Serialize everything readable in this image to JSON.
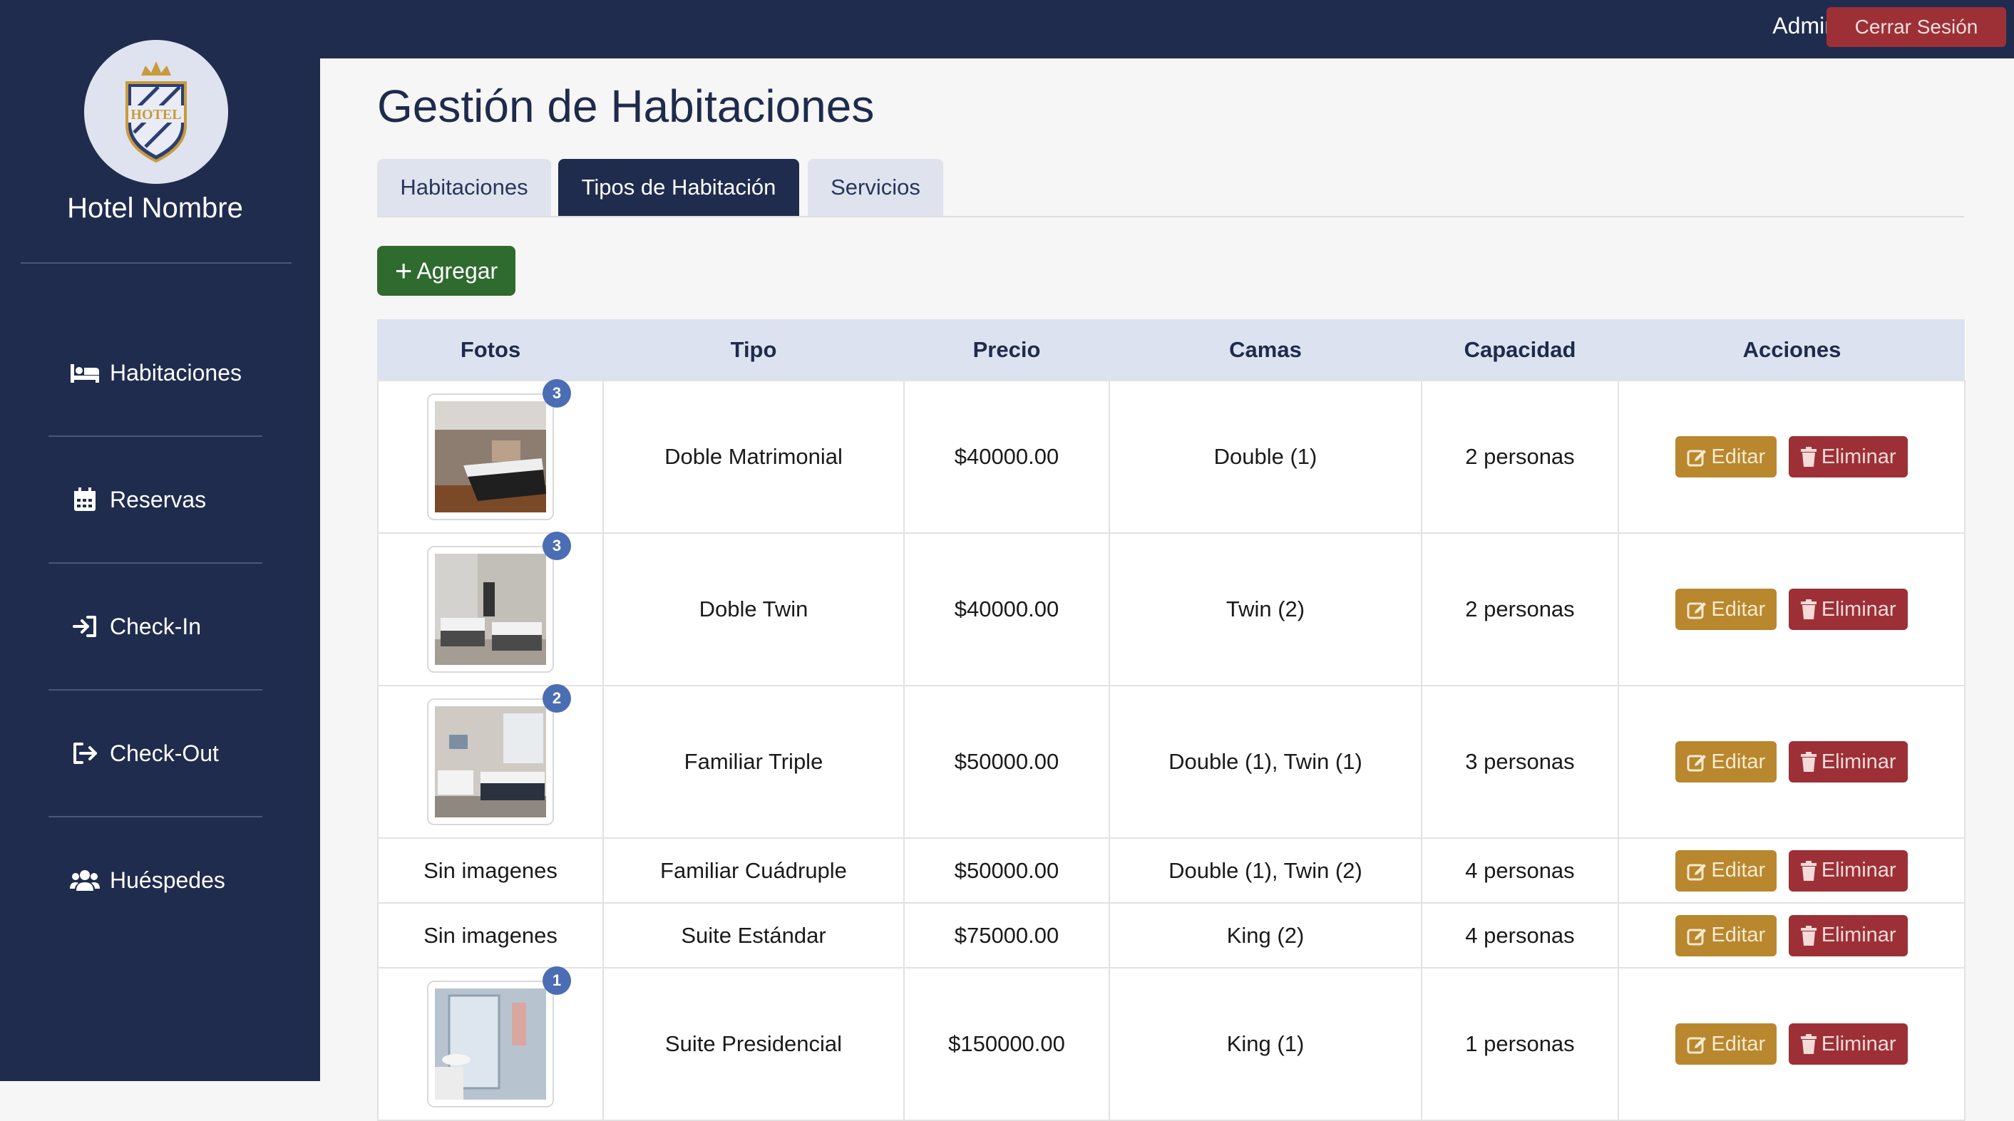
{
  "brand": {
    "hotel_name": "Hotel Nombre",
    "logo_text": "HOTEL"
  },
  "sidebar": {
    "items": [
      {
        "label": "Habitaciones",
        "icon": "bed-icon"
      },
      {
        "label": "Reservas",
        "icon": "calendar-icon"
      },
      {
        "label": "Check-In",
        "icon": "sign-in-icon"
      },
      {
        "label": "Check-Out",
        "icon": "sign-out-icon"
      },
      {
        "label": "Huéspedes",
        "icon": "users-icon"
      }
    ]
  },
  "topbar": {
    "user_label": "Admin",
    "logout_label": "Cerrar Sesión"
  },
  "page": {
    "title": "Gestión de Habitaciones"
  },
  "tabs": [
    {
      "label": "Habitaciones",
      "active": false
    },
    {
      "label": "Tipos de Habitación",
      "active": true
    },
    {
      "label": "Servicios",
      "active": false
    }
  ],
  "actions": {
    "add_label": "Agregar"
  },
  "table": {
    "headers": [
      "Fotos",
      "Tipo",
      "Precio",
      "Camas",
      "Capacidad",
      "Acciones"
    ],
    "edit_label": "Editar",
    "delete_label": "Eliminar",
    "rows": [
      {
        "photos": "3",
        "tipo": "Doble Matrimonial",
        "precio": "$40000.00",
        "camas": "Double (1)",
        "capacidad": "2 personas"
      },
      {
        "photos": "3",
        "tipo": "Doble Twin",
        "precio": "$40000.00",
        "camas": "Twin (2)",
        "capacidad": "2 personas"
      },
      {
        "photos": "2",
        "tipo": "Familiar Triple",
        "precio": "$50000.00",
        "camas": "Double (1), Twin (1)",
        "capacidad": "3 personas"
      },
      {
        "photos_text": "Sin imagenes",
        "tipo": "Familiar Cuádruple",
        "precio": "$50000.00",
        "camas": "Double (1), Twin (2)",
        "capacidad": "4 personas"
      },
      {
        "photos_text": "Sin imagenes",
        "tipo": "Suite Estándar",
        "precio": "$75000.00",
        "camas": "King (2)",
        "capacidad": "4 personas"
      },
      {
        "photos": "1",
        "tipo": "Suite Presidencial",
        "precio": "$150000.00",
        "camas": "King (1)",
        "capacidad": "1 personas"
      }
    ]
  },
  "colors": {
    "navy": "#1f2c4e",
    "success": "#2f6a2f",
    "warning": "#b8872e",
    "danger": "#9c3036",
    "badge": "#4b6db3"
  }
}
